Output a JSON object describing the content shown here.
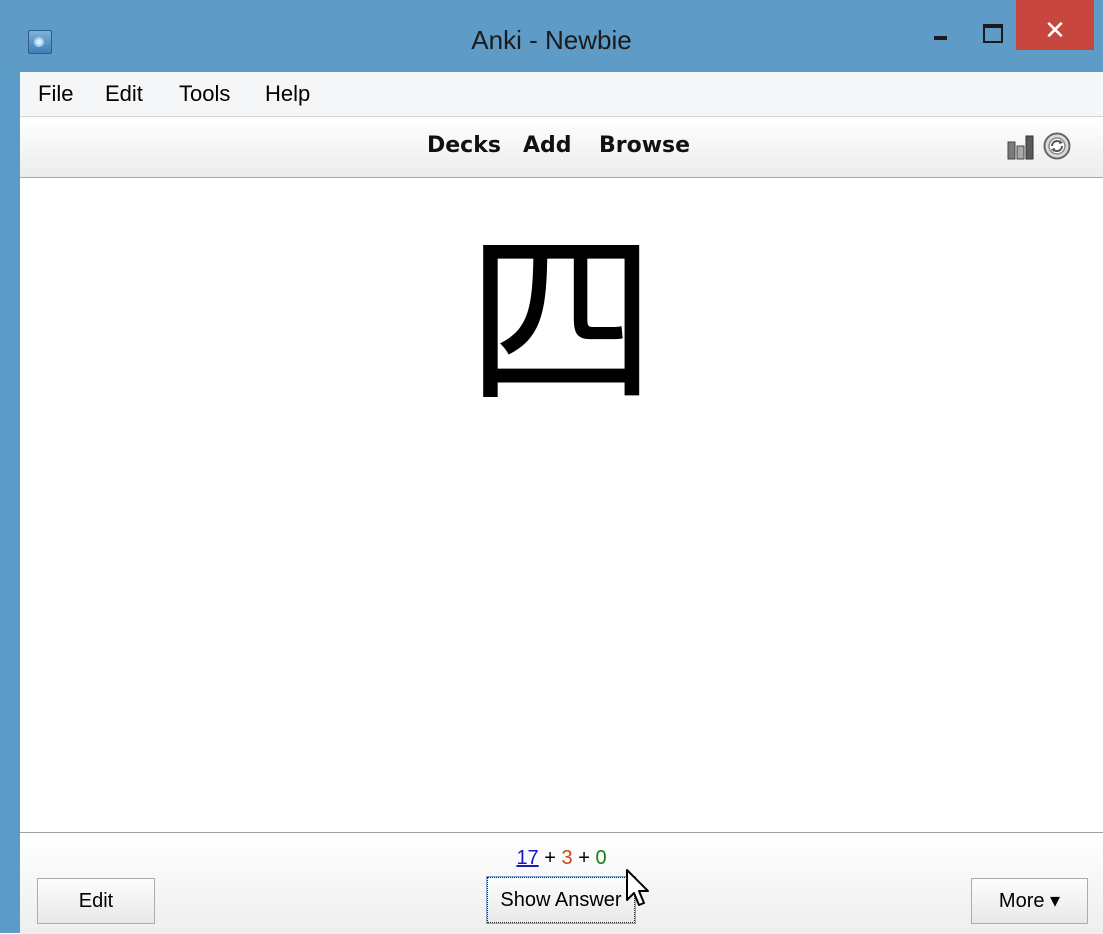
{
  "window": {
    "title": "Anki - Newbie",
    "close_glyph": "✕"
  },
  "menu": {
    "items": [
      "File",
      "Edit",
      "Tools",
      "Help"
    ]
  },
  "toolbar": {
    "links": [
      "Decks",
      "Add",
      "Browse"
    ],
    "icons": [
      "stats-icon",
      "sync-icon"
    ]
  },
  "card": {
    "front": "四"
  },
  "counts": {
    "new": "17",
    "plus1": "+",
    "learn": "3",
    "plus2": "+",
    "review": "0"
  },
  "buttons": {
    "edit": "Edit",
    "show_answer": "Show Answer",
    "more": "More ▾"
  },
  "colors": {
    "titlebar": "#5e9bc6",
    "close": "#c7463d",
    "count_new": "#1717c8",
    "count_learn": "#c44a1a",
    "count_review": "#16801b"
  }
}
